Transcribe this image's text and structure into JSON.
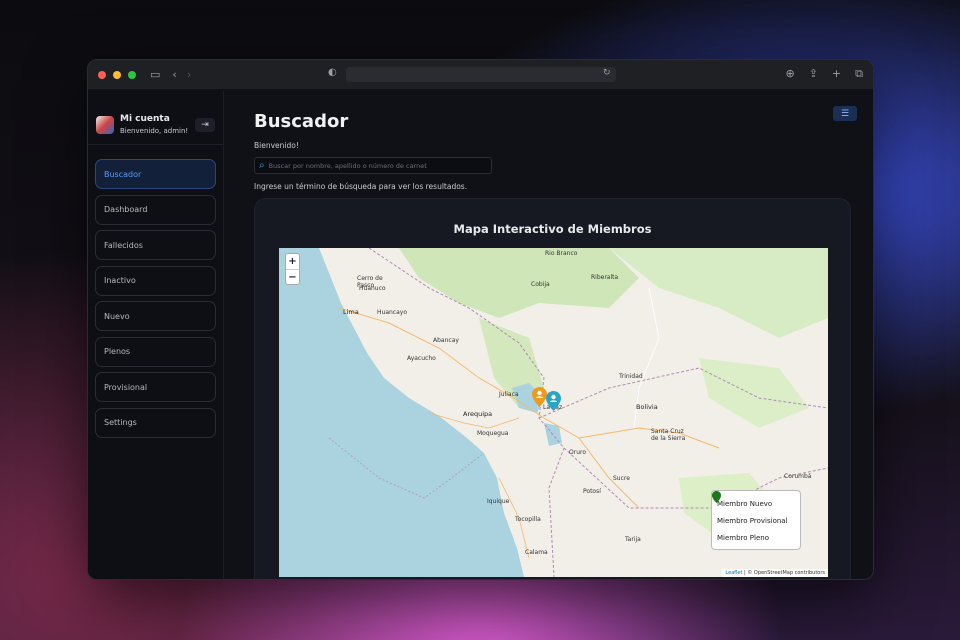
{
  "sidebar": {
    "account_name": "Mi cuenta",
    "account_sub": "Bienvenido, admin!",
    "items": [
      {
        "label": "Buscador"
      },
      {
        "label": "Dashboard"
      },
      {
        "label": "Fallecidos"
      },
      {
        "label": "Inactivo"
      },
      {
        "label": "Nuevo"
      },
      {
        "label": "Plenos"
      },
      {
        "label": "Provisional"
      },
      {
        "label": "Settings"
      }
    ]
  },
  "main": {
    "title": "Buscador",
    "welcome": "Bienvenido!",
    "search_placeholder": "Buscar por nombre, apellido o número de carnet",
    "hint": "Ingrese un término de búsqueda para ver los resultados."
  },
  "map": {
    "title": "Mapa Interactivo de Miembros",
    "zoom_in": "+",
    "zoom_out": "−",
    "legend": [
      {
        "label": "Miembro Nuevo",
        "color": "#2aa3c9"
      },
      {
        "label": "Miembro Provisional",
        "color": "#f09a1a"
      },
      {
        "label": "Miembro Pleno",
        "color": "#1a7a1a"
      }
    ],
    "attribution_leaflet": "Leaflet",
    "attribution_rest": " | © OpenStreetMap contributors",
    "cities": [
      {
        "name": "Rio Branco"
      },
      {
        "name": "Huánuco"
      },
      {
        "name": "Cerro de Pasco"
      },
      {
        "name": "Huancayo"
      },
      {
        "name": "Lima"
      },
      {
        "name": "Abancay"
      },
      {
        "name": "Ayacucho"
      },
      {
        "name": "Juliaca"
      },
      {
        "name": "Arequipa"
      },
      {
        "name": "Moquegua"
      },
      {
        "name": "Iquique"
      },
      {
        "name": "Tocopilla"
      },
      {
        "name": "Calama"
      },
      {
        "name": "Oruro"
      },
      {
        "name": "Sucre"
      },
      {
        "name": "Potosí"
      },
      {
        "name": "Tarija"
      },
      {
        "name": "Riberalta"
      },
      {
        "name": "Trinidad"
      },
      {
        "name": "Bolivia"
      },
      {
        "name": "Santa Cruz de la Sierra"
      },
      {
        "name": "Corumbá"
      },
      {
        "name": "Cobija"
      },
      {
        "name": "La Paz"
      }
    ]
  }
}
